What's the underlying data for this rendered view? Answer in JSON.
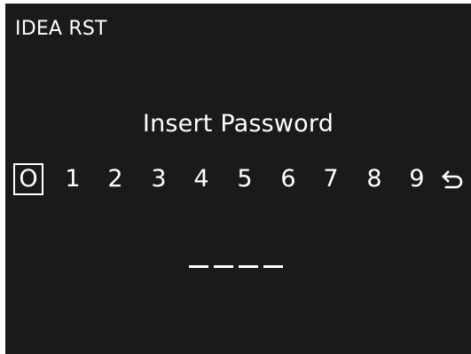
{
  "header": {
    "title": "IDEA RST"
  },
  "prompt": {
    "text": "Insert Password"
  },
  "keypad": {
    "keys": [
      "O",
      "1",
      "2",
      "3",
      "4",
      "5",
      "6",
      "7",
      "8",
      "9"
    ],
    "selected_key": "O",
    "back_icon": "return-arrow-icon"
  },
  "password": {
    "entered_digits": 0,
    "total_digits": 4
  },
  "colors": {
    "background": "#1a1a1a",
    "text": "#ffffff",
    "frame": "#ffffff"
  }
}
